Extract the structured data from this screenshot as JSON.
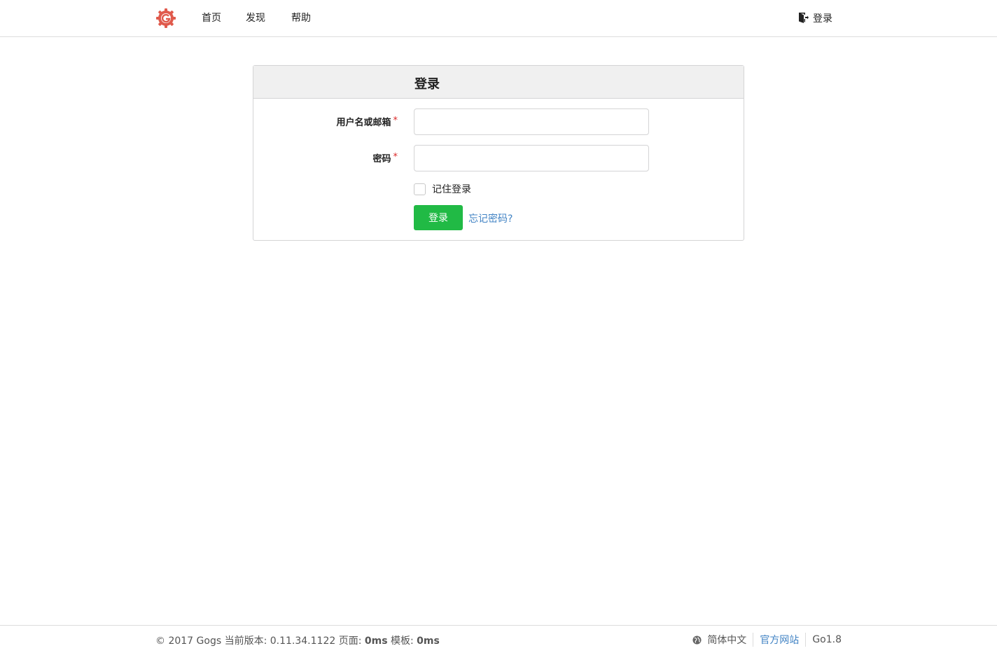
{
  "header": {
    "nav": {
      "home": "首页",
      "explore": "发现",
      "help": "帮助"
    },
    "signin_link": "登录",
    "colors": {
      "logo": "#e05a4c"
    }
  },
  "login": {
    "title": "登录",
    "username_label": "用户名或邮箱",
    "username_value": "",
    "password_label": "密码",
    "password_value": "",
    "required_mark": "*",
    "remember_label": "记住登录",
    "remember_checked": false,
    "submit_label": "登录",
    "forgot_label": "忘记密码?",
    "colors": {
      "submit_bg": "#21ba45",
      "link": "#4183c4",
      "required": "#db2828"
    }
  },
  "footer": {
    "copyright": "© 2017 Gogs 当前版本: 0.11.34.1122 页面: ",
    "page_time": "0ms",
    "template_label": " 模板: ",
    "template_time": "0ms",
    "language": "简体中文",
    "official_site": "官方网站",
    "go_version": "Go1.8"
  }
}
